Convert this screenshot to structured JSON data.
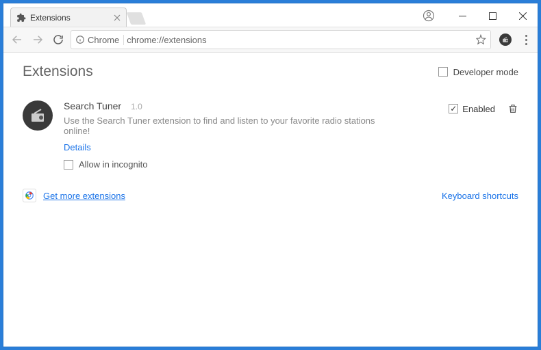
{
  "titlebar": {
    "tab_title": "Extensions"
  },
  "addressbar": {
    "chip": "Chrome",
    "url": "chrome://extensions"
  },
  "page": {
    "title": "Extensions",
    "devmode_label": "Developer mode",
    "extension": {
      "name": "Search Tuner",
      "version": "1.0",
      "description": "Use the Search Tuner extension to find and listen to your favorite radio stations online!",
      "details_label": "Details",
      "incognito_label": "Allow in incognito",
      "enabled_label": "Enabled",
      "enabled": true
    },
    "store_link": "Get more extensions",
    "shortcuts_link": "Keyboard shortcuts"
  }
}
